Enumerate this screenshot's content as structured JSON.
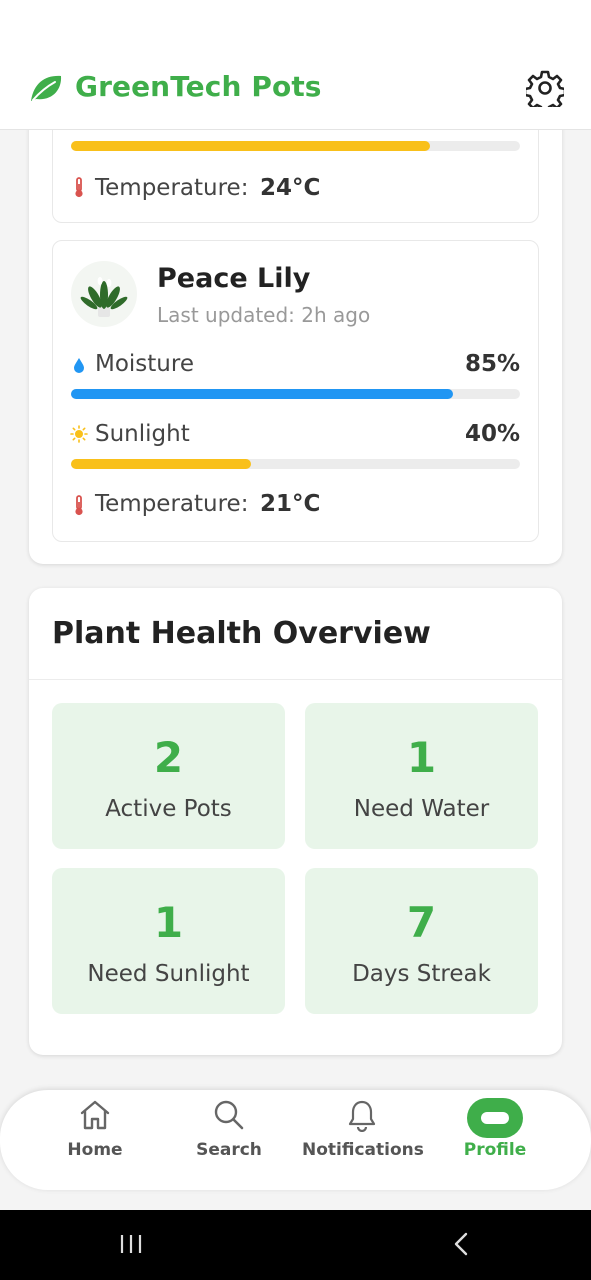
{
  "header": {
    "title": "GreenTech Pots",
    "settings_icon": "gear-icon",
    "logo_icon": "leaf-icon"
  },
  "colors": {
    "brand": "#3fae4a",
    "moisture": "#2196f3",
    "sunlight": "#f9c01a",
    "tile_bg": "#e8f5e9",
    "temp_icon": "#d9534f"
  },
  "plants": [
    {
      "sunlight_fill": 0.8,
      "temperature_label": "Temperature:",
      "temperature_value": "24°C"
    },
    {
      "name": "Peace Lily",
      "updated": "Last updated: 2h ago",
      "moisture_label": "Moisture",
      "moisture_value": "85%",
      "moisture_fill": 0.85,
      "sunlight_label": "Sunlight",
      "sunlight_value": "40%",
      "sunlight_fill": 0.4,
      "temperature_label": "Temperature:",
      "temperature_value": "21°C"
    }
  ],
  "overview": {
    "title": "Plant Health Overview",
    "stats": [
      {
        "value": "2",
        "label": "Active Pots"
      },
      {
        "value": "1",
        "label": "Need Water"
      },
      {
        "value": "1",
        "label": "Need Sunlight"
      },
      {
        "value": "7",
        "label": "Days Streak"
      }
    ]
  },
  "nav": {
    "items": [
      {
        "label": "Home",
        "icon": "home-icon"
      },
      {
        "label": "Search",
        "icon": "search-icon"
      },
      {
        "label": "Notifications",
        "icon": "bell-icon"
      },
      {
        "label": "Profile",
        "icon": "profile-pill-icon",
        "active": true
      }
    ]
  },
  "system_nav": {
    "recents_icon": "recents-icon",
    "back_icon": "back-icon"
  }
}
